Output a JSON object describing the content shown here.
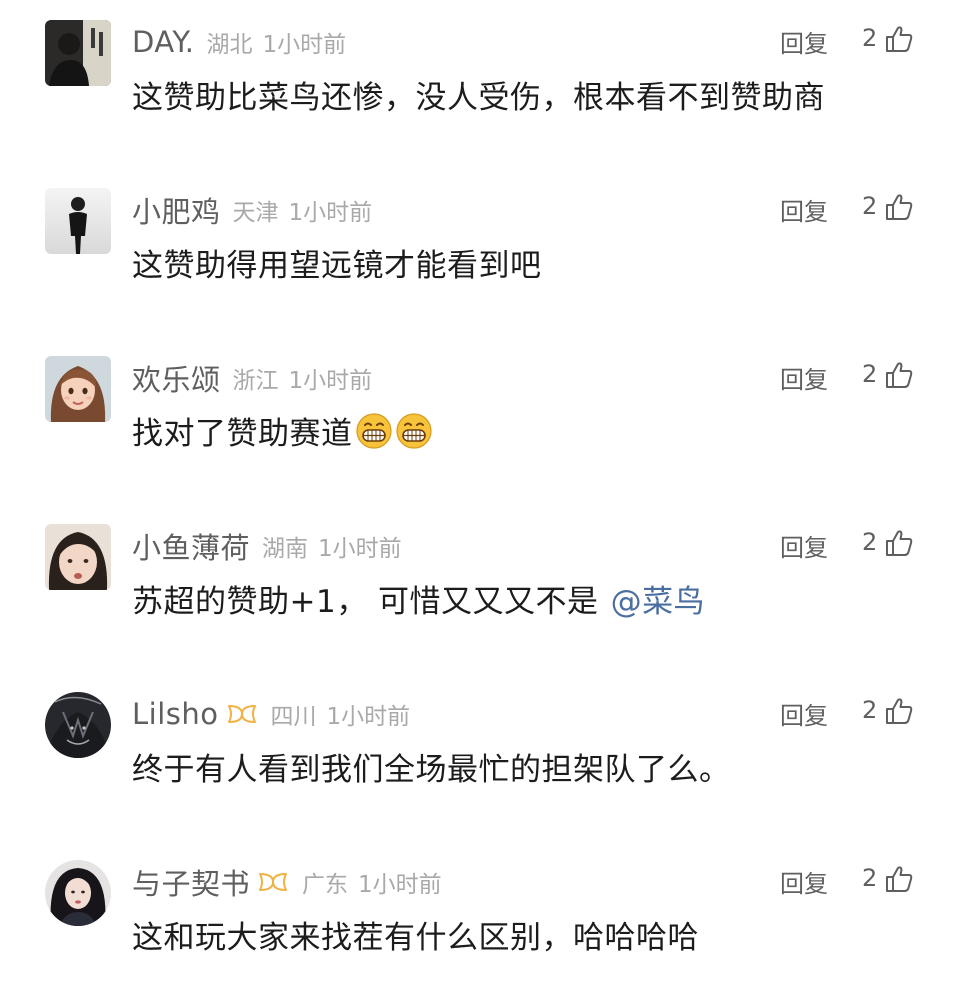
{
  "actions": {
    "reply_label": "回复"
  },
  "comments": [
    {
      "username": "DAY.",
      "region": "湖北",
      "time": "1小时前",
      "text": "这赞助比菜鸟还惨，没人受伤，根本看不到赞助商",
      "likes": "2",
      "avatar": "dark-portrait-avatar",
      "vip": false
    },
    {
      "username": "小肥鸡",
      "region": "天津",
      "time": "1小时前",
      "text": "这赞助得用望远镜才能看到吧",
      "likes": "2",
      "avatar": "person-in-suit-avatar",
      "vip": false
    },
    {
      "username": "欢乐颂",
      "region": "浙江",
      "time": "1小时前",
      "text": "找对了赞助赛道",
      "emojis": [
        "grinning-emoji",
        "grinning-emoji"
      ],
      "likes": "2",
      "avatar": "illustrated-girl-avatar",
      "vip": false
    },
    {
      "username": "小鱼薄荷",
      "region": "湖南",
      "time": "1小时前",
      "text": "苏超的赞助+1， 可惜又又又不是",
      "mention": "@菜鸟",
      "likes": "2",
      "avatar": "selfie-face-avatar",
      "vip": false
    },
    {
      "username": "Lilsho",
      "region": "四川",
      "time": "1小时前",
      "text": "终于有人看到我们全场最忙的担架队了么。",
      "likes": "2",
      "avatar": "dark-anime-avatar",
      "vip": true
    },
    {
      "username": "与子契书",
      "region": "广东",
      "time": "1小时前",
      "text": "这和玩大家来找茬有什么区别，哈哈哈哈",
      "likes": "2",
      "avatar": "dark-hair-girl-avatar",
      "vip": true
    }
  ],
  "colors": {
    "username": "#5f5f5f",
    "meta": "#a9a9a9",
    "text": "#1c1c1c",
    "mention": "#4a6ea0",
    "vip_badge": "#f0b244",
    "emoji": "#f7c33a"
  }
}
